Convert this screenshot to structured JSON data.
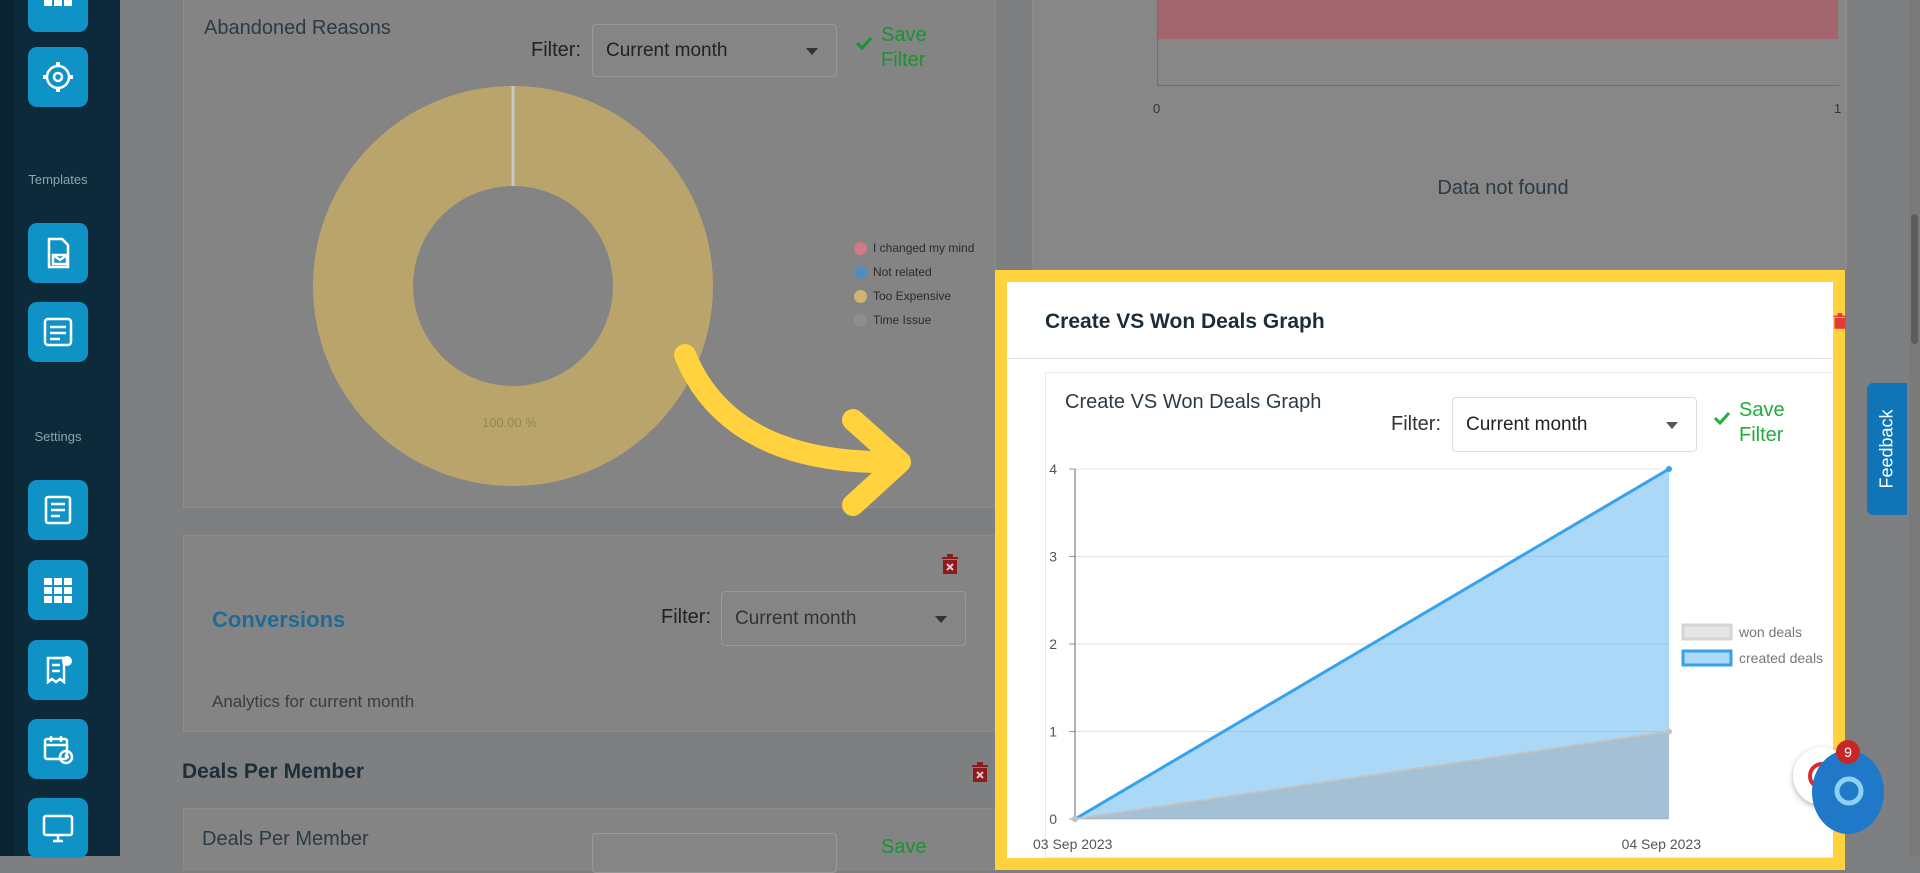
{
  "sidebar": {
    "section_templates": "Templates",
    "section_settings": "Settings"
  },
  "abandoned": {
    "title": "Abandoned Reasons",
    "filter_label": "Filter:",
    "filter_value": "Current month",
    "save_label_1": "Save",
    "save_label_2": "Filter",
    "legend": [
      {
        "label": "I changed my mind",
        "color": "#d07a88"
      },
      {
        "label": "Not related",
        "color": "#4f8cc0"
      },
      {
        "label": "Too Expensive",
        "color": "#cdb473"
      },
      {
        "label": "Time Issue",
        "color": "#8e8e8e"
      }
    ],
    "donut_label": "100.00 %"
  },
  "right_top": {
    "x_ticks": [
      "0",
      "1"
    ],
    "empty_text": "Data not found"
  },
  "conversions": {
    "title": "Conversions",
    "filter_label": "Filter:",
    "filter_value": "Current month",
    "subtitle": "Analytics for current month"
  },
  "deals_member": {
    "heading": "Deals Per Member",
    "inner_title": "Deals Per Member",
    "save_label": "Save"
  },
  "graph_card": {
    "header_title": "Create VS Won Deals Graph",
    "inner_title": "Create VS Won Deals Graph",
    "filter_label": "Filter:",
    "filter_value": "Current month",
    "save_label_1": "Save",
    "save_label_2": "Filter"
  },
  "chart_data": {
    "type": "area",
    "x": [
      "03 Sep 2023",
      "04 Sep 2023"
    ],
    "ylim": [
      0,
      4
    ],
    "yticks": [
      0,
      1,
      2,
      3,
      4
    ],
    "grid": true,
    "legend_position": "right",
    "series": [
      {
        "name": "won deals",
        "values": [
          0,
          1
        ],
        "color": "#d9d9d9"
      },
      {
        "name": "created deals",
        "values": [
          0,
          4
        ],
        "color": "#36a2eb"
      }
    ]
  },
  "feedback": {
    "label": "Feedback"
  },
  "chat": {
    "badge": "9"
  },
  "colors": {
    "highlight": "#ffd23e",
    "accent": "#0f93c6",
    "save": "#17952f"
  }
}
